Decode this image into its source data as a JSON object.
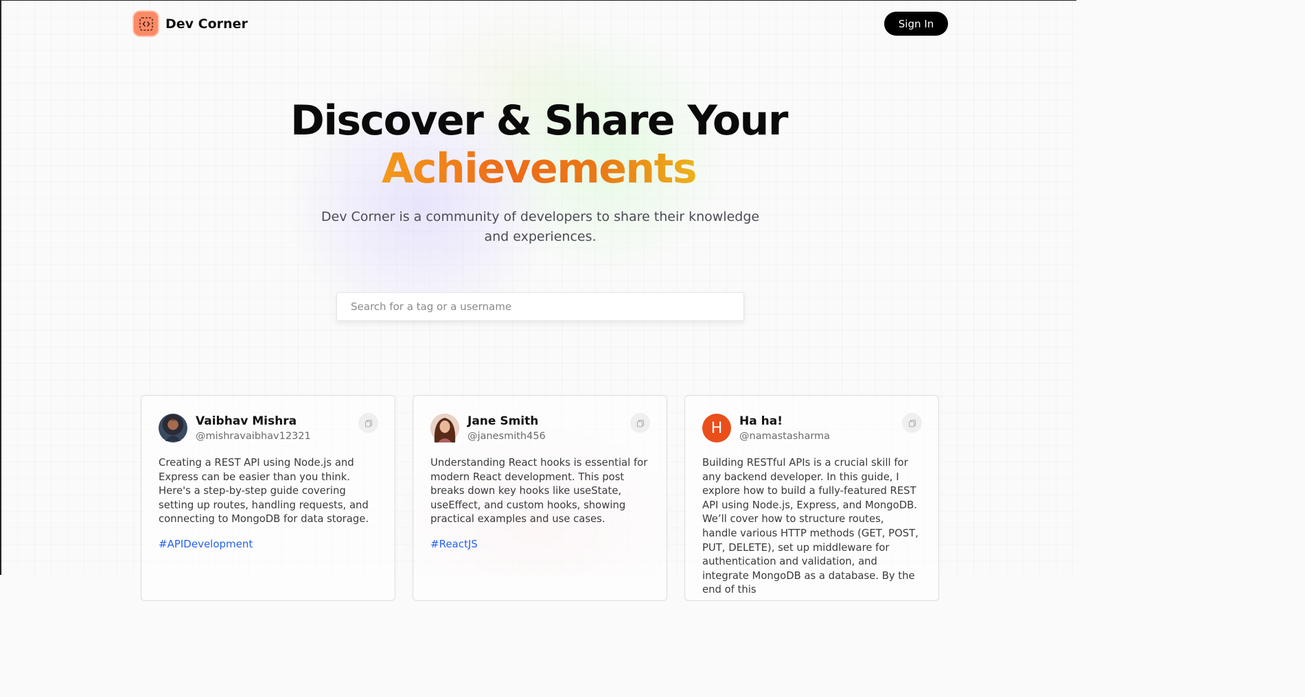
{
  "header": {
    "brand": "Dev Corner",
    "signin_label": "Sign In"
  },
  "hero": {
    "title_line1": "Discover & Share Your",
    "title_line2": "Achievements",
    "subtitle": "Dev Corner is a community of developers to share their knowledge and experiences."
  },
  "search": {
    "placeholder": "Search for a tag or a username",
    "value": ""
  },
  "colors": {
    "brand_orange": "#fb8a66",
    "accent_start": "#f39a1a",
    "accent_mid": "#ee6a1a",
    "accent_end": "#ecb21c",
    "tag_blue": "#2563eb",
    "avatar_h": "#ea4e1b"
  },
  "posts": [
    {
      "name": "Vaibhav Mishra",
      "handle": "@mishravaibhav12321",
      "avatar": "photo",
      "body": "Creating a REST API using Node.js and Express can be easier than you think. Here's a step-by-step guide covering setting up routes, handling requests, and connecting to MongoDB for data storage.",
      "tag": "#APIDevelopment"
    },
    {
      "name": "Jane Smith",
      "handle": "@janesmith456",
      "avatar": "photo",
      "body": "Understanding React hooks is essential for modern React development. This post breaks down key hooks like useState, useEffect, and custom hooks, showing practical examples and use cases.",
      "tag": "#ReactJS"
    },
    {
      "name": "Ha ha!",
      "handle": "@namastasharma",
      "avatar_initial": "H",
      "body": "Building RESTful APIs is a crucial skill for any backend developer. In this guide, I explore how to build a fully-featured REST API using Node.js, Express, and MongoDB. We’ll cover how to structure routes, handle various HTTP methods (GET, POST, PUT, DELETE), set up middleware for authentication and validation, and integrate MongoDB as a database. By the end of this",
      "tag": ""
    }
  ],
  "icons": {
    "logo": "code-bracket-icon",
    "copy": "copy-icon"
  }
}
